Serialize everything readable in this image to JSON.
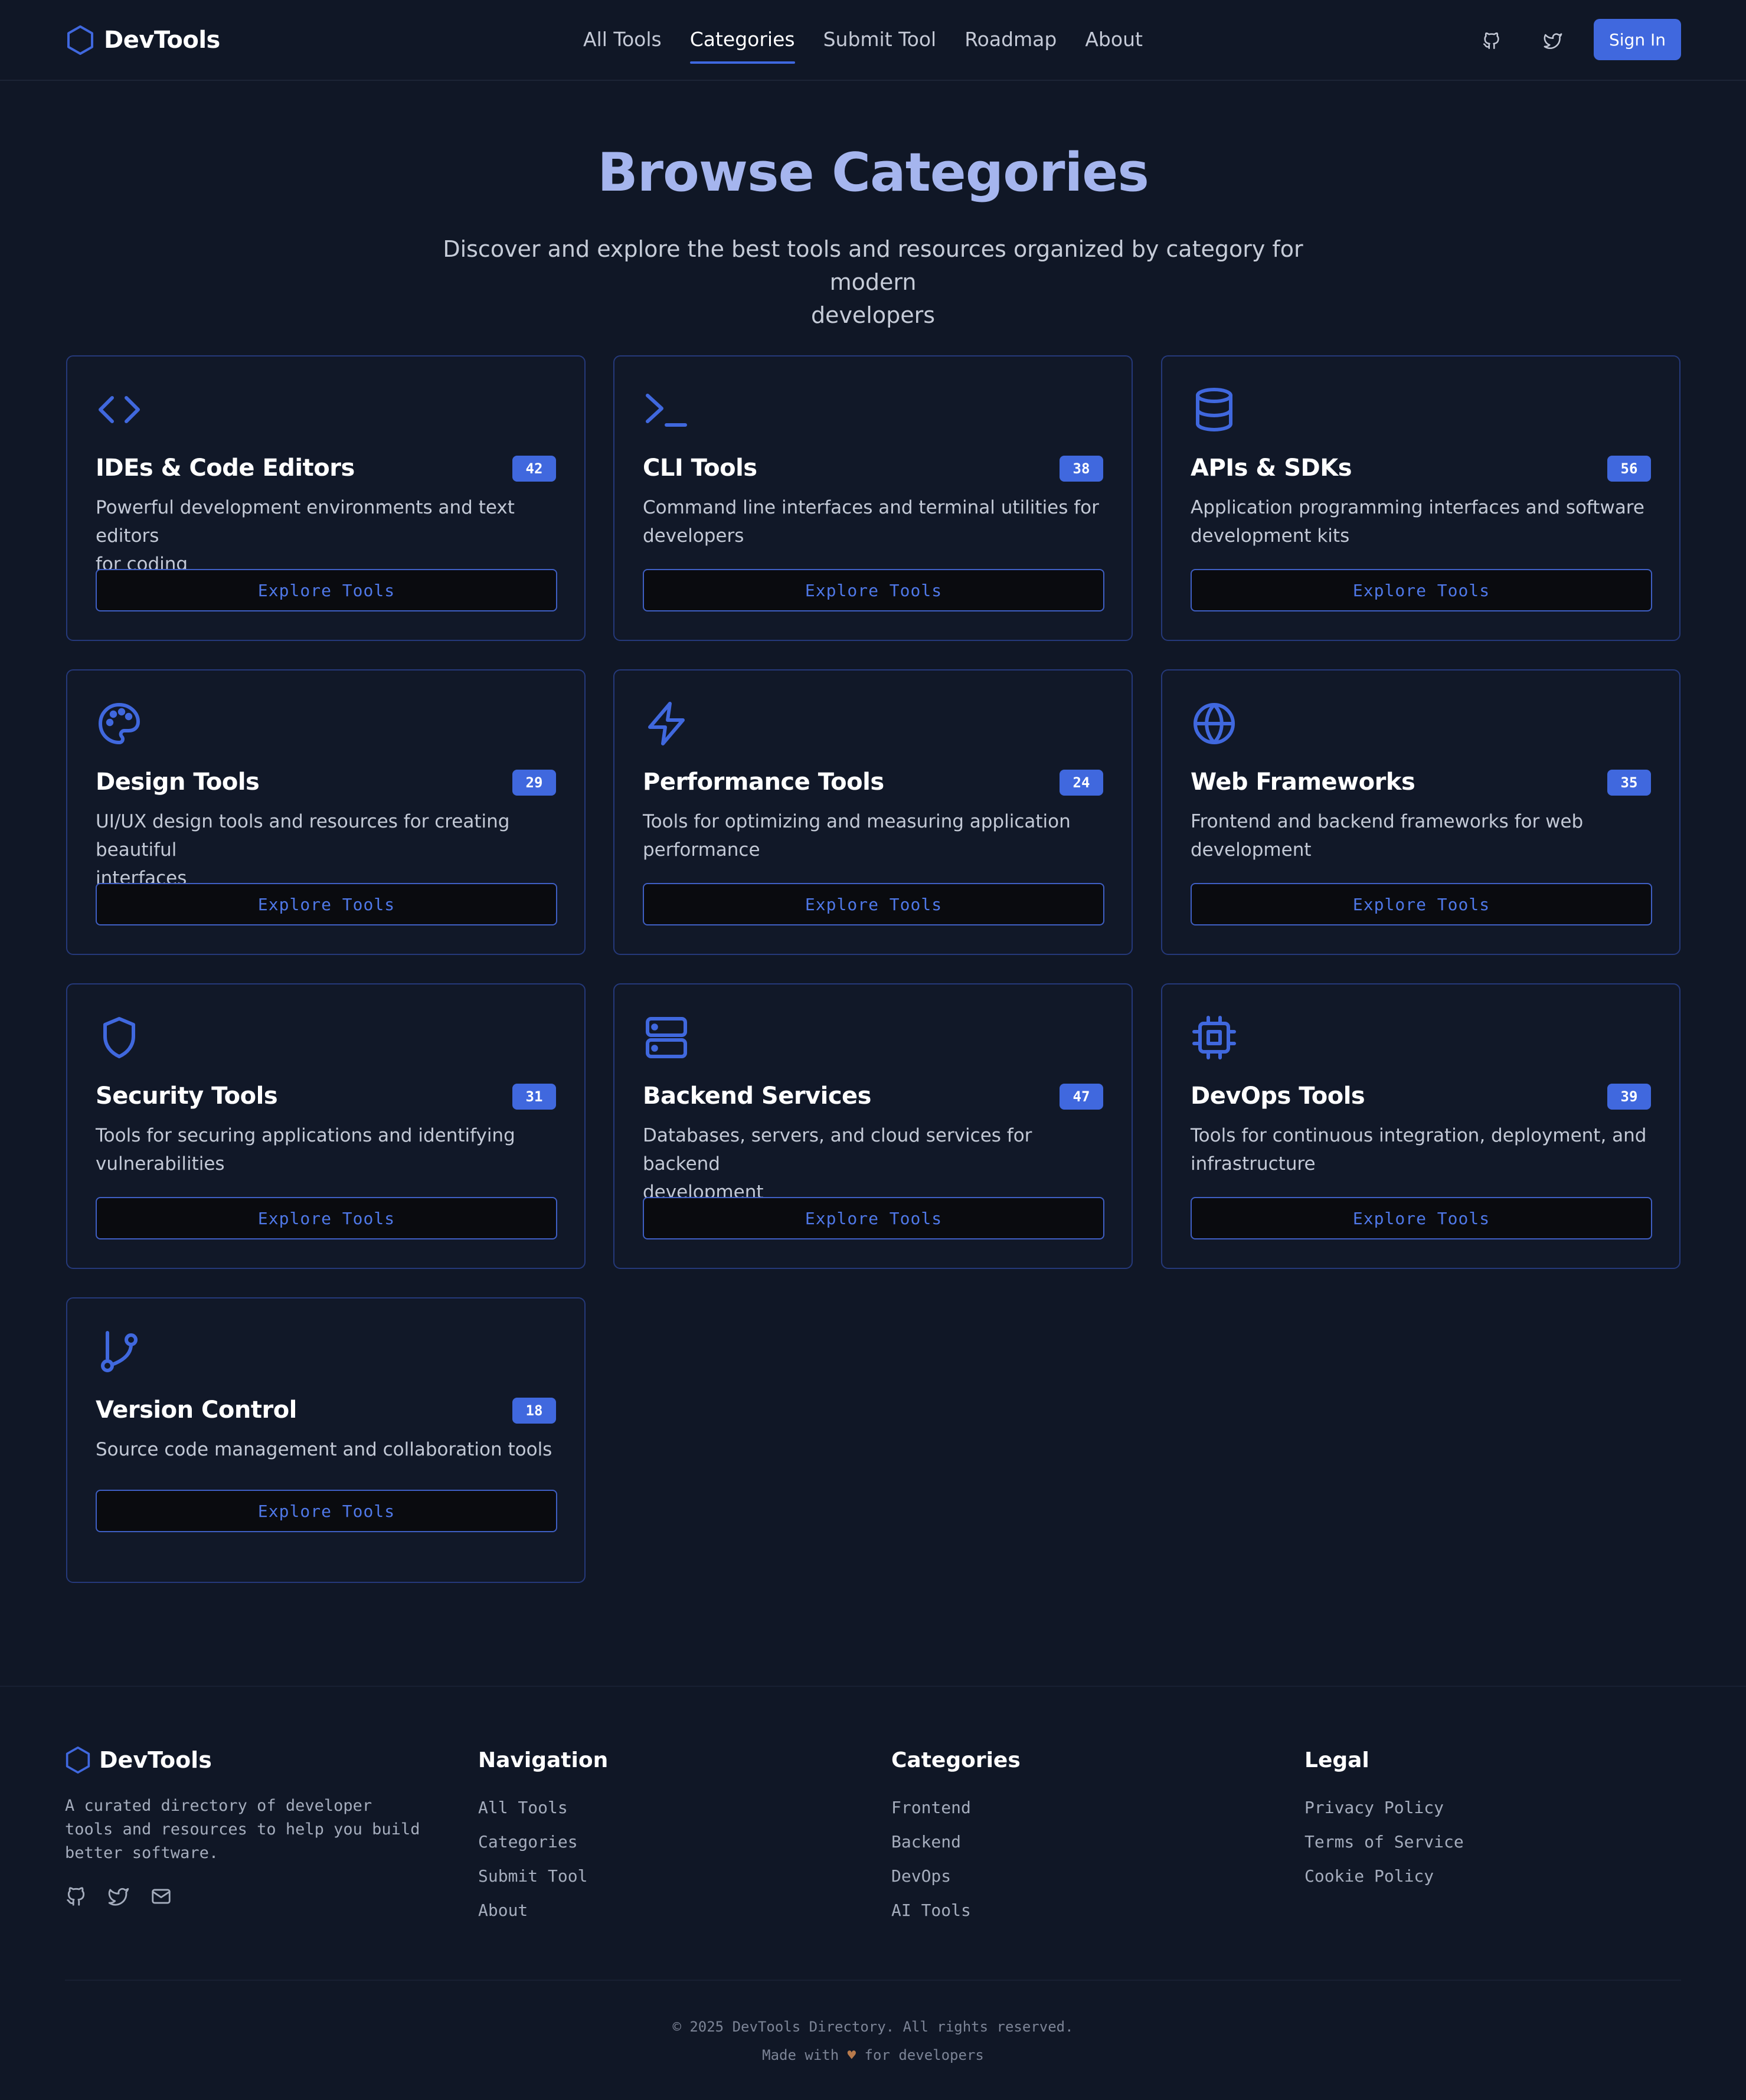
{
  "header": {
    "brand": "DevTools",
    "nav": [
      {
        "label": "All Tools",
        "active": false
      },
      {
        "label": "Categories",
        "active": true
      },
      {
        "label": "Submit Tool",
        "active": false
      },
      {
        "label": "Roadmap",
        "active": false
      },
      {
        "label": "About",
        "active": false
      }
    ],
    "sign_in": "Sign In"
  },
  "hero": {
    "title": "Browse Categories",
    "subtitle_line1": "Discover and explore the best tools and resources organized by category for modern",
    "subtitle_line2": "developers"
  },
  "categories": [
    {
      "icon": "code-icon",
      "title": "IDEs & Code Editors",
      "count": "42",
      "desc1": "Powerful development environments and text editors",
      "desc2": "for coding",
      "button": "Explore Tools"
    },
    {
      "icon": "terminal-icon",
      "title": "CLI Tools",
      "count": "38",
      "desc1": "Command line interfaces and terminal utilities for",
      "desc2": "developers",
      "button": "Explore Tools"
    },
    {
      "icon": "database-icon",
      "title": "APIs & SDKs",
      "count": "56",
      "desc1": "Application programming interfaces and software",
      "desc2": "development kits",
      "button": "Explore Tools"
    },
    {
      "icon": "palette-icon",
      "title": "Design Tools",
      "count": "29",
      "desc1": "UI/UX design tools and resources for creating beautiful",
      "desc2": "interfaces",
      "button": "Explore Tools"
    },
    {
      "icon": "lightning-icon",
      "title": "Performance Tools",
      "count": "24",
      "desc1": "Tools for optimizing and measuring application",
      "desc2": "performance",
      "button": "Explore Tools"
    },
    {
      "icon": "globe-icon",
      "title": "Web Frameworks",
      "count": "35",
      "desc1": "Frontend and backend frameworks for web",
      "desc2": "development",
      "button": "Explore Tools"
    },
    {
      "icon": "shield-icon",
      "title": "Security Tools",
      "count": "31",
      "desc1": "Tools for securing applications and identifying",
      "desc2": "vulnerabilities",
      "button": "Explore Tools"
    },
    {
      "icon": "server-icon",
      "title": "Backend Services",
      "count": "47",
      "desc1": "Databases, servers, and cloud services for backend",
      "desc2": "development",
      "button": "Explore Tools"
    },
    {
      "icon": "cpu-icon",
      "title": "DevOps Tools",
      "count": "39",
      "desc1": "Tools for continuous integration, deployment, and",
      "desc2": "infrastructure",
      "button": "Explore Tools"
    },
    {
      "icon": "git-branch-icon",
      "title": "Version Control",
      "count": "18",
      "desc1": "Source code management and collaboration tools",
      "desc2": "",
      "button": "Explore Tools"
    }
  ],
  "footer": {
    "brand": "DevTools",
    "desc1": "A curated directory of developer",
    "desc2": "tools and resources to help you build",
    "desc3": "better software.",
    "navigation": {
      "title": "Navigation",
      "links": [
        "All Tools",
        "Categories",
        "Submit Tool",
        "About"
      ]
    },
    "categories": {
      "title": "Categories",
      "links": [
        "Frontend",
        "Backend",
        "DevOps",
        "AI Tools"
      ]
    },
    "legal": {
      "title": "Legal",
      "links": [
        "Privacy Policy",
        "Terms of Service",
        "Cookie Policy"
      ]
    },
    "copyright": "© 2025 DevTools Directory. All rights reserved.",
    "made_pre": "Made with",
    "made_heart": "♥",
    "made_post": "for developers"
  },
  "colors": {
    "background": "#101726",
    "accent": "#4068de",
    "hero_title": "#a5b5ee",
    "card_border": "#25397a"
  }
}
